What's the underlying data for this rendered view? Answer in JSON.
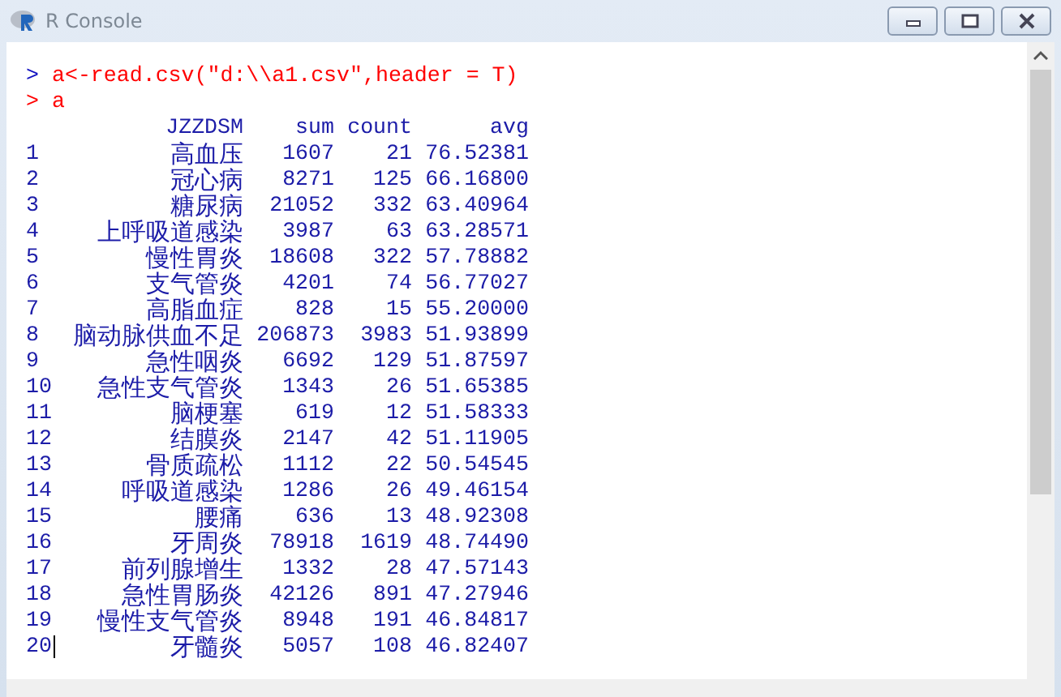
{
  "window": {
    "title": "R Console"
  },
  "commands": [
    {
      "prompt": ">",
      "color": "#1010c0",
      "text": "a<-read.csv(\"d:\\\\a1.csv\",header = T)"
    },
    {
      "prompt": ">",
      "color": "#ff0000",
      "text": "a"
    }
  ],
  "table": {
    "columns": [
      "JZZDSM",
      "sum",
      "count",
      "avg"
    ],
    "rows": [
      {
        "index": "1",
        "name": "高血压",
        "sum": "1607",
        "count": "21",
        "avg": "76.52381"
      },
      {
        "index": "2",
        "name": "冠心病",
        "sum": "8271",
        "count": "125",
        "avg": "66.16800"
      },
      {
        "index": "3",
        "name": "糖尿病",
        "sum": "21052",
        "count": "332",
        "avg": "63.40964"
      },
      {
        "index": "4",
        "name": "上呼吸道感染",
        "sum": "3987",
        "count": "63",
        "avg": "63.28571"
      },
      {
        "index": "5",
        "name": "慢性胃炎",
        "sum": "18608",
        "count": "322",
        "avg": "57.78882"
      },
      {
        "index": "6",
        "name": "支气管炎",
        "sum": "4201",
        "count": "74",
        "avg": "56.77027"
      },
      {
        "index": "7",
        "name": "高脂血症",
        "sum": "828",
        "count": "15",
        "avg": "55.20000"
      },
      {
        "index": "8",
        "name": "脑动脉供血不足",
        "sum": "206873",
        "count": "3983",
        "avg": "51.93899"
      },
      {
        "index": "9",
        "name": "急性咽炎",
        "sum": "6692",
        "count": "129",
        "avg": "51.87597"
      },
      {
        "index": "10",
        "name": "急性支气管炎",
        "sum": "1343",
        "count": "26",
        "avg": "51.65385"
      },
      {
        "index": "11",
        "name": "脑梗塞",
        "sum": "619",
        "count": "12",
        "avg": "51.58333"
      },
      {
        "index": "12",
        "name": "结膜炎",
        "sum": "2147",
        "count": "42",
        "avg": "51.11905"
      },
      {
        "index": "13",
        "name": "骨质疏松",
        "sum": "1112",
        "count": "22",
        "avg": "50.54545"
      },
      {
        "index": "14",
        "name": "呼吸道感染",
        "sum": "1286",
        "count": "26",
        "avg": "49.46154"
      },
      {
        "index": "15",
        "name": "腰痛",
        "sum": "636",
        "count": "13",
        "avg": "48.92308"
      },
      {
        "index": "16",
        "name": "牙周炎",
        "sum": "78918",
        "count": "1619",
        "avg": "48.74490"
      },
      {
        "index": "17",
        "name": "前列腺增生",
        "sum": "1332",
        "count": "28",
        "avg": "47.57143"
      },
      {
        "index": "18",
        "name": "急性胃肠炎",
        "sum": "42126",
        "count": "891",
        "avg": "47.27946"
      },
      {
        "index": "19",
        "name": "慢性支气管炎",
        "sum": "8948",
        "count": "191",
        "avg": "46.84817"
      },
      {
        "index": "20",
        "name": "牙髓炎",
        "sum": "5057",
        "count": "108",
        "avg": "46.82407"
      }
    ]
  }
}
